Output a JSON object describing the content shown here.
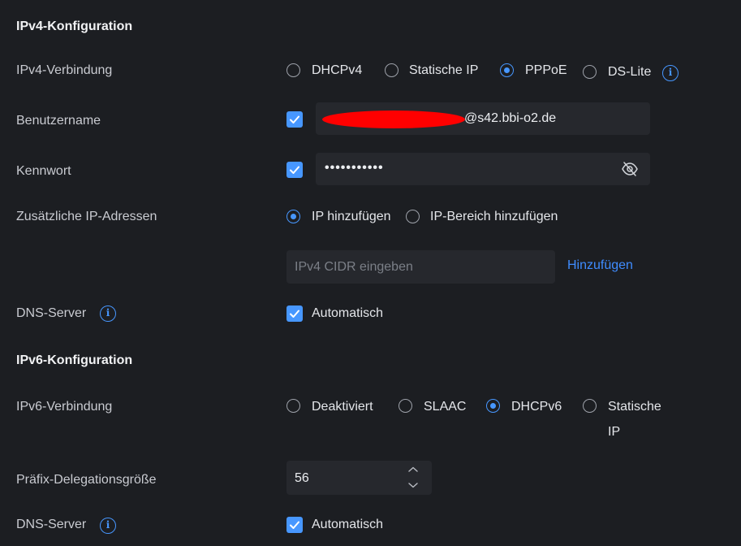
{
  "ipv4": {
    "title": "IPv4-Konfiguration",
    "connection_label": "IPv4-Verbindung",
    "connection_options": [
      "DHCPv4",
      "Statische IP",
      "PPPoE",
      "DS-Lite"
    ],
    "selected_connection": "PPPoE",
    "username_label": "Benutzername",
    "username_value_visible": "@s42.bbi-o2.de",
    "password_label": "Kennwort",
    "password_value": "•••••••••••",
    "additional_ip_label": "Zusätzliche IP-Adressen",
    "additional_ip_options": [
      "IP hinzufügen",
      "IP-Bereich hinzufügen"
    ],
    "selected_additional_ip": "IP hinzufügen",
    "cidr_placeholder": "IPv4 CIDR eingeben",
    "add_link": "Hinzufügen",
    "dns_label": "DNS-Server",
    "dns_auto_label": "Automatisch"
  },
  "ipv6": {
    "title": "IPv6-Konfiguration",
    "connection_label": "IPv6-Verbindung",
    "connection_options": [
      "Deaktiviert",
      "SLAAC",
      "DHCPv6",
      "Statische",
      "IP"
    ],
    "selected_connection": "DHCPv6",
    "prefix_label": "Präfix-Delegationsgröße",
    "prefix_value": "56",
    "dns_label": "DNS-Server",
    "dns_auto_label": "Automatisch"
  },
  "colors": {
    "background": "#1c1e22",
    "accent": "#4797ff",
    "field": "#26282d",
    "redaction": "#ff0000"
  },
  "icons": [
    "info-icon",
    "eye-off-icon",
    "check-icon",
    "chevron-up-icon",
    "chevron-down-icon"
  ]
}
